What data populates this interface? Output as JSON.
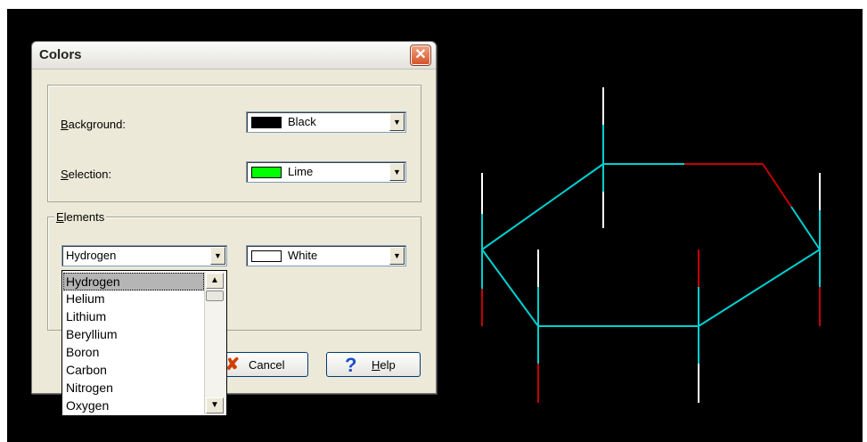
{
  "dialog": {
    "title": "Colors",
    "background_label_accel": "B",
    "background_label_rest": "ackground:",
    "background_value": "Black",
    "selection_label_accel": "S",
    "selection_label_rest": "election:",
    "selection_value": "Lime",
    "elements_legend_accel": "E",
    "elements_legend_rest": "lements",
    "element_selected": "Hydrogen",
    "element_color": "White",
    "element_options": [
      "Hydrogen",
      "Helium",
      "Lithium",
      "Beryllium",
      "Boron",
      "Carbon",
      "Nitrogen",
      "Oxygen"
    ],
    "cancel_label": "Cancel",
    "help_label_accel": "H",
    "help_label_rest": "elp"
  },
  "colors": {
    "black": "#000000",
    "lime": "#00ff00",
    "white": "#ffffff",
    "bond_carbon": "#00d0d0",
    "bond_oxygen": "#c80000",
    "bond_hydrogen": "#ffffff"
  },
  "icons": {
    "close": "close-icon",
    "cancel": "cancel-x-icon",
    "help": "help-question-icon",
    "dropdown_arrow": "chevron-down-icon"
  }
}
